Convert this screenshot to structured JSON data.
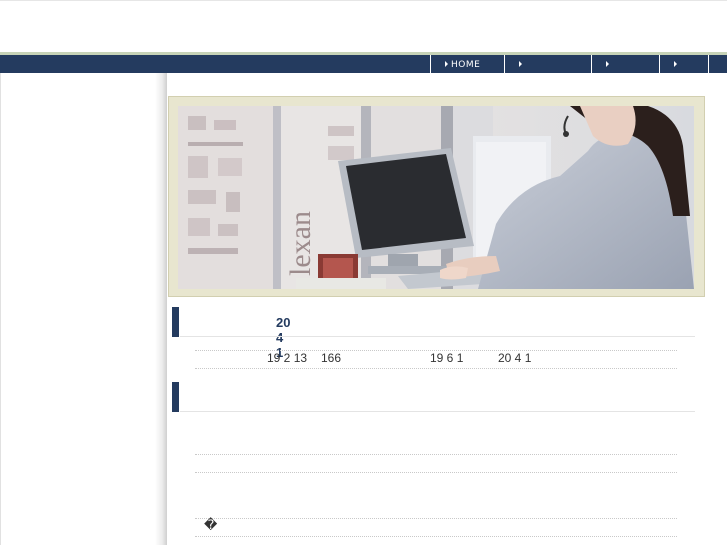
{
  "nav": {
    "items": [
      {
        "label": "HOME"
      },
      {
        "label": ""
      },
      {
        "label": ""
      },
      {
        "label": ""
      }
    ]
  },
  "section1": {
    "title": "20 4 1"
  },
  "info": {
    "text_a": "19 2 13",
    "text_b": "166",
    "text_c": "19 6 1",
    "text_d": "20 4 1"
  },
  "section2": {
    "title": ""
  },
  "footer": {
    "glyph": "�"
  },
  "colors": {
    "nav_bg": "#243b5f",
    "banner_frame": "#e8e6cf",
    "accent_line": "#c7d3b7"
  }
}
